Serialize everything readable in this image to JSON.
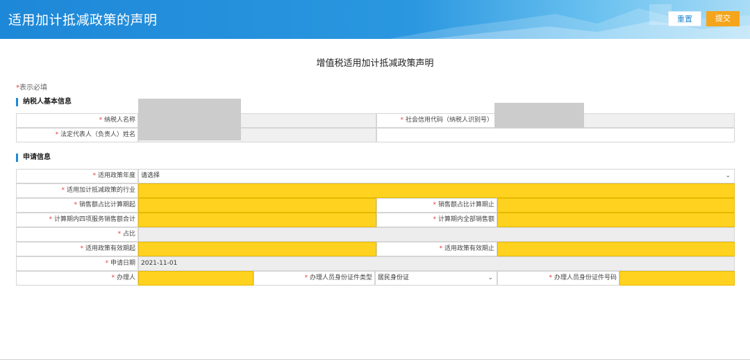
{
  "header": {
    "title": "适用加计抵减政策的声明",
    "reset_label": "重置",
    "submit_label": "提交"
  },
  "form": {
    "title": "增值税适用加计抵减政策声明",
    "required_star": "*",
    "required_note": "表示必填"
  },
  "basic_info": {
    "section_title": "纳税人基本信息",
    "taxpayer_name_label": "纳税人名称",
    "credit_code_label": "社会信用代码（纳税人识别号）",
    "legal_rep_label": "法定代表人（负责人）姓名"
  },
  "application": {
    "section_title": "申请信息",
    "policy_year_label": "适用政策年度",
    "policy_year_value": "请选择",
    "industry_label": "适用加计抵减政策的行业",
    "sales_ratio_start_label": "销售额占比计算期起",
    "sales_ratio_end_label": "销售额占比计算期止",
    "four_services_total_label": "计算期内四项服务销售额合计",
    "total_sales_label": "计算期内全部销售额",
    "ratio_label": "占比",
    "valid_start_label": "适用政策有效期起",
    "valid_end_label": "适用政策有效期止",
    "apply_date_label": "申请日期",
    "apply_date_value": "2021-11-01",
    "handler_label": "办理人",
    "id_type_label": "办理人员身份证件类型",
    "id_type_value": "居民身份证",
    "id_number_label": "办理人员身份证件号码"
  },
  "icons": {
    "chevron": "chevron-down-icon"
  },
  "colors": {
    "header_blue": "#1e88d8",
    "submit_orange": "#f4a51c",
    "required_yellow": "#ffd21f",
    "required_red": "#e53935"
  }
}
